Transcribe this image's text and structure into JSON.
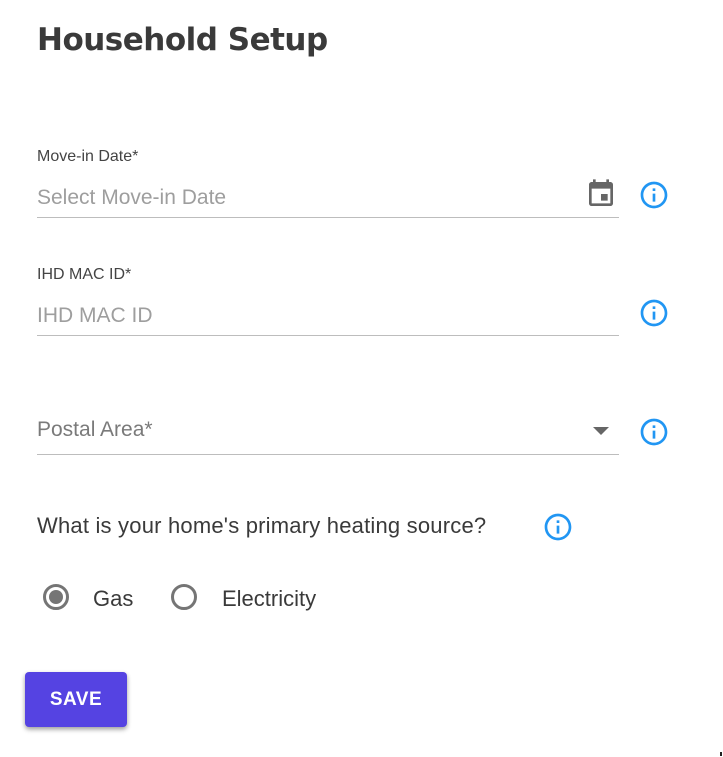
{
  "page": {
    "title": "Household Setup"
  },
  "form": {
    "move_in": {
      "label": "Move-in Date*",
      "placeholder": "Select Move-in Date",
      "value": "",
      "icon": "calendar-icon"
    },
    "ihd_mac": {
      "label": "IHD MAC ID*",
      "placeholder": "IHD MAC ID",
      "value": ""
    },
    "postal_area": {
      "placeholder": "Postal Area*",
      "selected": ""
    },
    "heating": {
      "question": "What is your home's primary heating source?",
      "options": [
        {
          "label": "Gas",
          "selected": true
        },
        {
          "label": "Electricity",
          "selected": false
        }
      ]
    },
    "save_label": "SAVE"
  },
  "colors": {
    "info_icon": "#2196f3",
    "primary_button": "#5543e2",
    "radio": "#757575",
    "underline": "#bdbdbd"
  }
}
